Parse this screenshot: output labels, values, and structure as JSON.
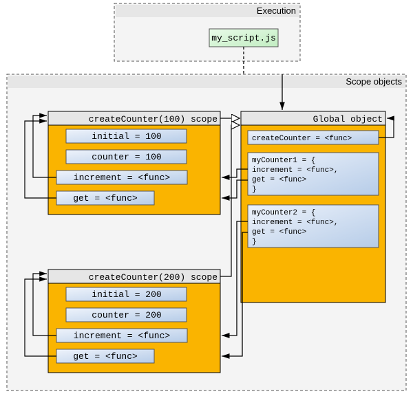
{
  "execution": {
    "title": "Execution",
    "script": "my_script.js"
  },
  "scope": {
    "title": "Scope objects",
    "global": {
      "title": "Global object",
      "createCounter": "createCounter = <func>",
      "myCounter1": {
        "line1": "myCounter1 = {",
        "line2": " increment = <func>,",
        "line3": " get = <func>",
        "line4": "}"
      },
      "myCounter2": {
        "line1": "myCounter2 = {",
        "line2": " increment = <func>,",
        "line3": " get = <func>",
        "line4": "}"
      }
    },
    "scope100": {
      "title": "createCounter(100) scope",
      "initial": "initial = 100",
      "counter": "counter = 100",
      "increment": "increment = <func>",
      "get": "get = <func>"
    },
    "scope200": {
      "title": "createCounter(200) scope",
      "initial": "initial = 200",
      "counter": "counter = 200",
      "increment": "increment = <func>",
      "get": "get = <func>"
    }
  }
}
